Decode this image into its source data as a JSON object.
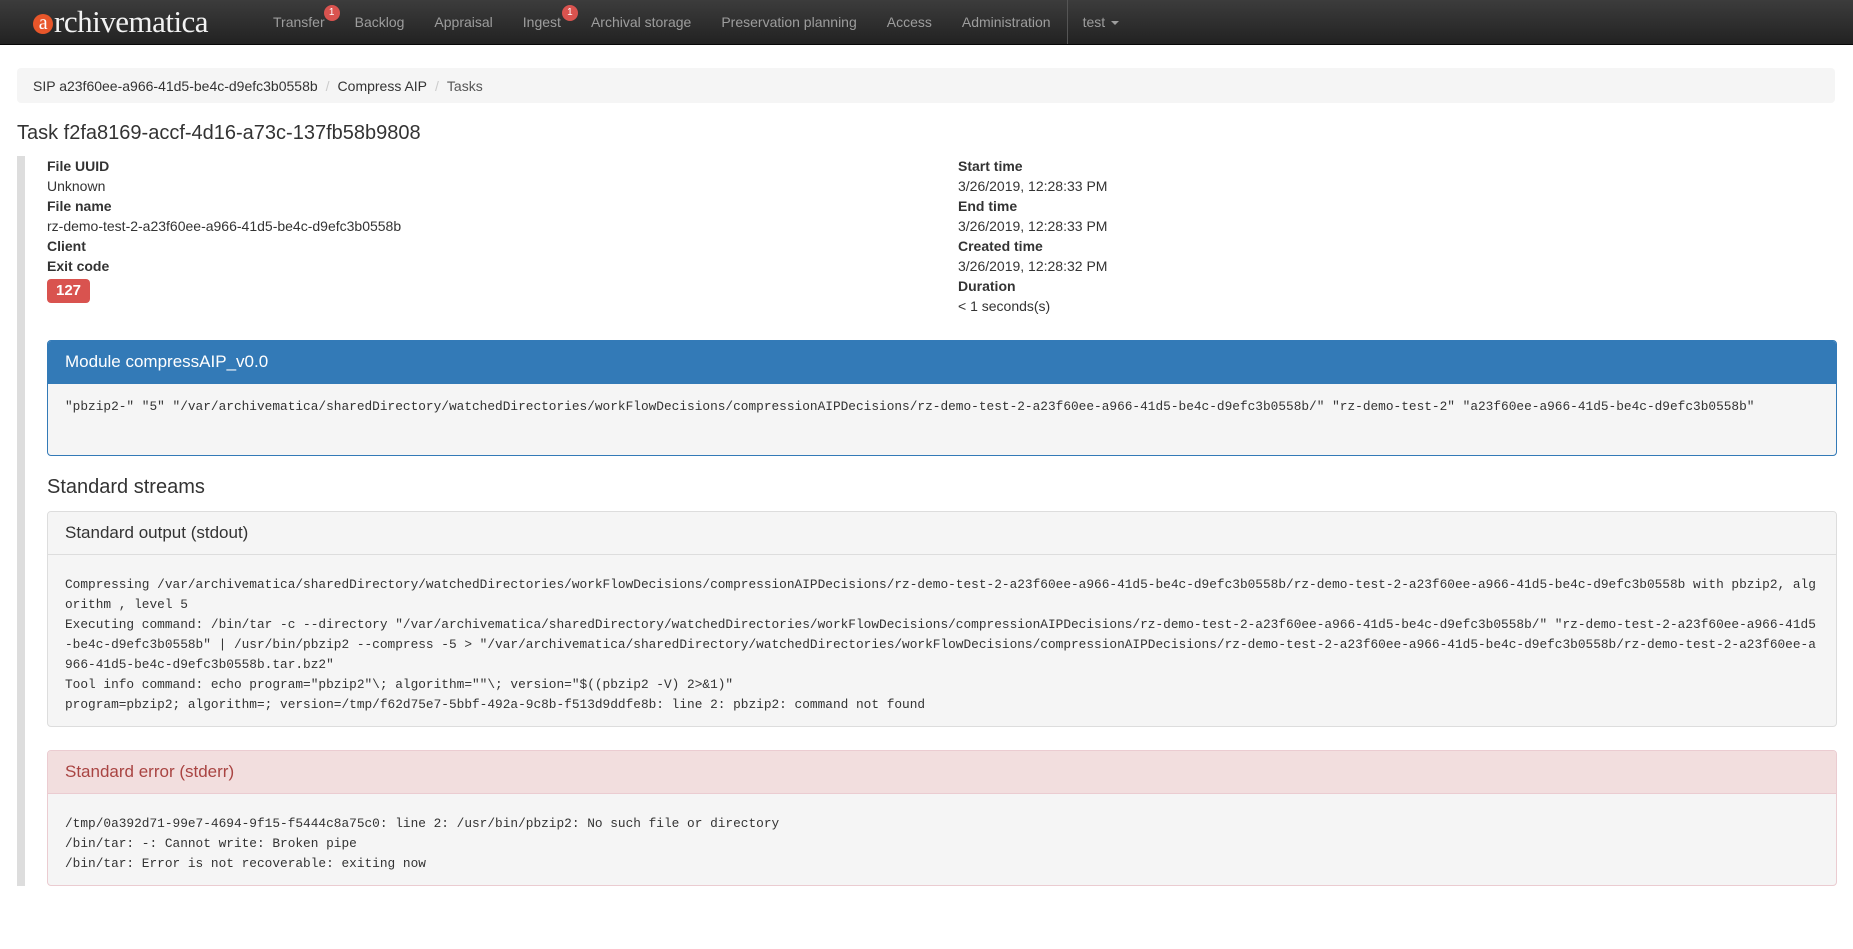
{
  "nav": {
    "brand": "rchivematica",
    "brand_mark": "a",
    "items": [
      {
        "label": "Transfer",
        "badge": "1"
      },
      {
        "label": "Backlog"
      },
      {
        "label": "Appraisal"
      },
      {
        "label": "Ingest",
        "badge": "1"
      },
      {
        "label": "Archival storage"
      },
      {
        "label": "Preservation planning"
      },
      {
        "label": "Access"
      },
      {
        "label": "Administration"
      }
    ],
    "user": "test"
  },
  "breadcrumb": {
    "sip": "SIP a23f60ee-a966-41d5-be4c-d9efc3b0558b",
    "job": "Compress AIP",
    "current": "Tasks"
  },
  "task": {
    "title": "Task f2fa8169-accf-4d16-a73c-137fb58b9808",
    "file_uuid_label": "File UUID",
    "file_uuid": "Unknown",
    "file_name_label": "File name",
    "file_name": "rz-demo-test-2-a23f60ee-a966-41d5-be4c-d9efc3b0558b",
    "client_label": "Client",
    "client": "",
    "exit_code_label": "Exit code",
    "exit_code": "127",
    "start_time_label": "Start time",
    "start_time": "3/26/2019, 12:28:33 PM",
    "end_time_label": "End time",
    "end_time": "3/26/2019, 12:28:33 PM",
    "created_time_label": "Created time",
    "created_time": "3/26/2019, 12:28:32 PM",
    "duration_label": "Duration",
    "duration": "< 1 seconds(s)"
  },
  "module": {
    "heading": "Module compressAIP_v0.0",
    "arguments": "\"pbzip2-\" \"5\" \"/var/archivematica/sharedDirectory/watchedDirectories/workFlowDecisions/compressionAIPDecisions/rz-demo-test-2-a23f60ee-a966-41d5-be4c-d9efc3b0558b/\" \"rz-demo-test-2\" \"a23f60ee-a966-41d5-be4c-d9efc3b0558b\""
  },
  "streams": {
    "title": "Standard streams",
    "stdout_heading": "Standard output (stdout)",
    "stdout": "Compressing /var/archivematica/sharedDirectory/watchedDirectories/workFlowDecisions/compressionAIPDecisions/rz-demo-test-2-a23f60ee-a966-41d5-be4c-d9efc3b0558b/rz-demo-test-2-a23f60ee-a966-41d5-be4c-d9efc3b0558b with pbzip2, algorithm , level 5\nExecuting command: /bin/tar -c --directory \"/var/archivematica/sharedDirectory/watchedDirectories/workFlowDecisions/compressionAIPDecisions/rz-demo-test-2-a23f60ee-a966-41d5-be4c-d9efc3b0558b/\" \"rz-demo-test-2-a23f60ee-a966-41d5-be4c-d9efc3b0558b\" | /usr/bin/pbzip2 --compress -5 > \"/var/archivematica/sharedDirectory/watchedDirectories/workFlowDecisions/compressionAIPDecisions/rz-demo-test-2-a23f60ee-a966-41d5-be4c-d9efc3b0558b/rz-demo-test-2-a23f60ee-a966-41d5-be4c-d9efc3b0558b.tar.bz2\"\nTool info command: echo program=\"pbzip2\"\\; algorithm=\"\"\\; version=\"$((pbzip2 -V) 2>&1)\"\nprogram=pbzip2; algorithm=; version=/tmp/f62d75e7-5bbf-492a-9c8b-f513d9ddfe8b: line 2: pbzip2: command not found",
    "stderr_heading": "Standard error (stderr)",
    "stderr": "/tmp/0a392d71-99e7-4694-9f15-f5444c8a75c0: line 2: /usr/bin/pbzip2: No such file or directory\n/bin/tar: -: Cannot write: Broken pipe\n/bin/tar: Error is not recoverable: exiting now"
  },
  "colors": {
    "navbar": "#222222",
    "primary": "#337ab7",
    "danger": "#d9534f",
    "brand_accent": "#e8562a"
  }
}
